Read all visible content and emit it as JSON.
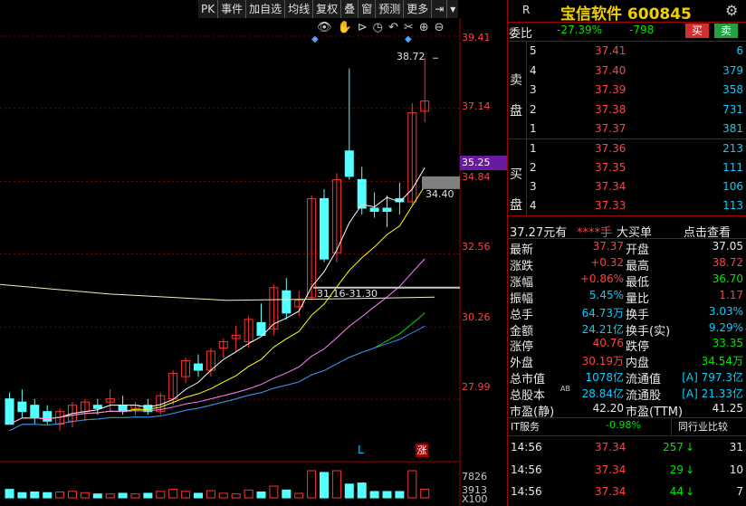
{
  "toolbar": {
    "buttons": [
      "PK",
      "事件",
      "加自选",
      "均线",
      "复权",
      "叠",
      "窗",
      "预测",
      "更多"
    ]
  },
  "chart": {
    "price_axis": [
      "39.41",
      "37.14",
      "34.84",
      "32.56",
      "30.26",
      "27.99"
    ],
    "current_price_tag": "35.25",
    "high_annotation": "38.72",
    "level_annotation": "34.40",
    "range_annotation": "31.16-31.30",
    "marker_l": "L",
    "marker_zhang": "涨",
    "volume_axis": [
      "7826",
      "3913",
      "X100"
    ],
    "colors": {
      "up": "#ff3232",
      "down": "#54ffff",
      "ma5": "#ffffff",
      "ma10": "#ffff00",
      "ma20": "#ff80ff",
      "ma30": "#00e000",
      "ma60": "#4080ff"
    }
  },
  "header": {
    "r_label": "R",
    "title": "宝信软件 600845",
    "gear_icon": "gear-icon"
  },
  "weibi": {
    "label": "委比",
    "pct": "-27.39%",
    "diff": "-798",
    "buy_btn": "买",
    "sell_btn": "卖"
  },
  "sell_side": {
    "label": "卖盘",
    "rows": [
      {
        "level": "5",
        "price": "37.41",
        "vol": "6"
      },
      {
        "level": "4",
        "price": "37.40",
        "vol": "379"
      },
      {
        "level": "3",
        "price": "37.39",
        "vol": "358"
      },
      {
        "level": "2",
        "price": "37.38",
        "vol": "731"
      },
      {
        "level": "1",
        "price": "37.37",
        "vol": "381"
      }
    ]
  },
  "buy_side": {
    "label": "买盘",
    "rows": [
      {
        "level": "1",
        "price": "37.36",
        "vol": "213"
      },
      {
        "level": "2",
        "price": "37.35",
        "vol": "111"
      },
      {
        "level": "3",
        "price": "37.34",
        "vol": "106"
      },
      {
        "level": "4",
        "price": "37.33",
        "vol": "113"
      }
    ]
  },
  "bigorder": {
    "price": "37.27元有",
    "stars": "****手",
    "label": "大买单",
    "link": "点击查看"
  },
  "stats": [
    {
      "l1": "最新",
      "v1": "37.37",
      "c1": "red",
      "l2": "开盘",
      "v2": "37.05",
      "c2": "white"
    },
    {
      "l1": "涨跌",
      "v1": "+0.32",
      "c1": "red",
      "l2": "最高",
      "v2": "38.72",
      "c2": "red"
    },
    {
      "l1": "涨幅",
      "v1": "+0.86%",
      "c1": "red",
      "l2": "最低",
      "v2": "36.70",
      "c2": "green"
    },
    {
      "l1": "振幅",
      "v1": "5.45%",
      "c1": "cyan",
      "l2": "量比",
      "v2": "1.17",
      "c2": "red"
    },
    {
      "l1": "总手",
      "v1": "64.73万",
      "c1": "cyan",
      "l2": "换手",
      "v2": "3.03%",
      "c2": "cyan"
    },
    {
      "l1": "金额",
      "v1": "24.21亿",
      "c1": "cyan",
      "l2": "换手(实)",
      "v2": "9.29%",
      "c2": "cyan"
    },
    {
      "l1": "涨停",
      "v1": "40.76",
      "c1": "red",
      "l2": "跌停",
      "v2": "33.35",
      "c2": "green"
    },
    {
      "l1": "外盘",
      "v1": "30.19万",
      "c1": "red",
      "l2": "内盘",
      "v2": "34.54万",
      "c2": "green"
    },
    {
      "l1": "总市值",
      "v1": "1078亿",
      "c1": "cyan",
      "l2": "流通值",
      "v2": "[A] 797.3亿",
      "c2": "cyan"
    },
    {
      "l1": "总股本",
      "v1": "28.84亿",
      "c1": "cyan",
      "l2": "流通股",
      "v2": "[A] 21.33亿",
      "c2": "cyan"
    },
    {
      "l1": "市盈(静)",
      "v1": "42.20",
      "c1": "white",
      "l2": "市盈(TTM)",
      "v2": "41.25",
      "c2": "white"
    }
  ],
  "ab_mark": "AB",
  "sector": {
    "name": "IT服务",
    "pct": "-0.98%",
    "compare": "同行业比较"
  },
  "ticks": [
    {
      "time": "14:56",
      "price": "37.34",
      "vol": "257",
      "n": "31"
    },
    {
      "time": "14:56",
      "price": "37.34",
      "vol": "29",
      "n": "10"
    },
    {
      "time": "14:56",
      "price": "37.34",
      "vol": "44",
      "n": "7"
    }
  ]
}
